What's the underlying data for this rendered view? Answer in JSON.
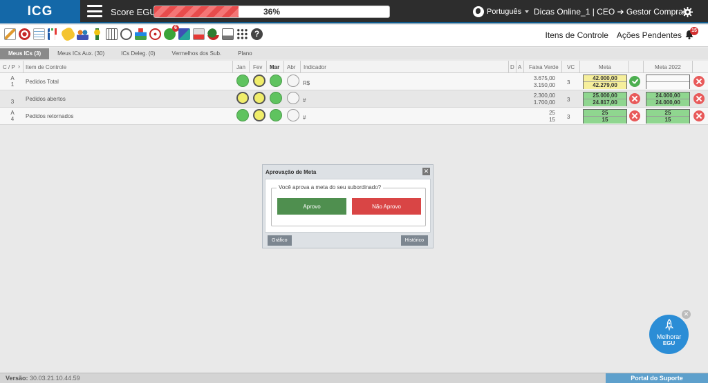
{
  "header": {
    "logo": "ICG",
    "score_label": "Score EGU:",
    "score_value": "36%",
    "score_percent": 36,
    "language": "Português",
    "user": "Dicas Online_1  |  CEO ➔ Gestor Compras"
  },
  "toolbar": {
    "links": [
      "Itens de Controle",
      "Ações Pendentes"
    ],
    "badge_tasks": "6",
    "badge_bell": "15"
  },
  "tabs": [
    "Meus ICs (3)",
    "Meus ICs Aux. (30)",
    "ICs Deleg. (0)",
    "Vermelhos dos Sub.",
    "Plano"
  ],
  "table": {
    "headers": {
      "cp": "C / P",
      "item": "Item de Controle",
      "jan": "Jan",
      "fev": "Fev",
      "mar": "Mar",
      "abr": "Abr",
      "indicador": "Indicador",
      "d": "D",
      "a": "A",
      "faixa": "Faixa Verde",
      "vc": "VC",
      "meta": "Meta",
      "meta2022": "Meta 2022"
    },
    "rows": [
      {
        "cp_top": "A",
        "cp_bottom": "1",
        "item": "Pedidos Total",
        "indicador": "R$",
        "faixa1": "3.675,00",
        "faixa2": "3.150,00",
        "vc": "3",
        "meta1": "42.000,00",
        "meta2": "42.279,00",
        "meta2022_1": "",
        "meta2022_2": ""
      },
      {
        "cp_top": "",
        "cp_bottom": "3",
        "item": "Pedidos abertos",
        "indicador": "#",
        "faixa1": "2.300,00",
        "faixa2": "1.700,00",
        "vc": "3",
        "meta1": "25.000,00",
        "meta2": "24.817,00",
        "meta2022_1": "24.000,00",
        "meta2022_2": "24.000,00"
      },
      {
        "cp_top": "A",
        "cp_bottom": "4",
        "item": "Pedidos retornados",
        "indicador": "#",
        "faixa1": "25",
        "faixa2": "15",
        "vc": "3",
        "meta1": "25",
        "meta2": "15",
        "meta2022_1": "25",
        "meta2022_2": "15"
      }
    ]
  },
  "modal": {
    "title": "Aprovação de Meta",
    "question": "Você aprova a meta do seu subordinado?",
    "approve": "Aprovo",
    "reject": "Não Aprovo",
    "chart_button": "Gráfico",
    "history_button": "Histórico"
  },
  "fab": {
    "line1": "Melhorar",
    "line2": "EGU"
  },
  "footer": {
    "version_label": "Versão:",
    "version_value": "30.03.21.10.44.59",
    "portal": "Portal do Suporte"
  }
}
